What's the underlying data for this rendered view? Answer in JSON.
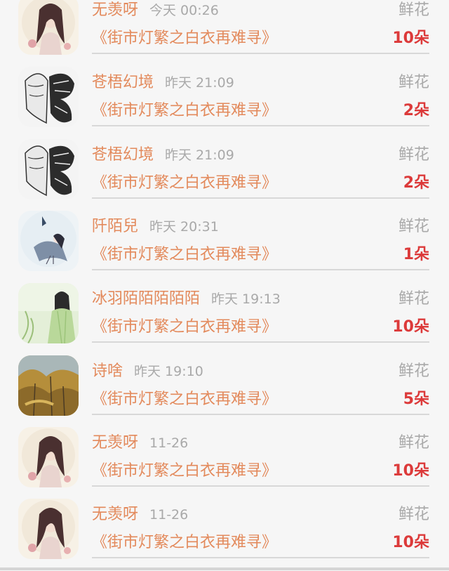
{
  "rows": [
    {
      "name": "无羡呀",
      "time": "今天 00:26",
      "gift": "鲜花",
      "book": "《街市灯繁之白衣再难寻》",
      "count": "10朵",
      "avatar": "girl-portrait"
    },
    {
      "name": "苍梧幻境",
      "time": "昨天 21:09",
      "gift": "鲜花",
      "book": "《街市灯繁之白衣再难寻》",
      "count": "2朵",
      "avatar": "butterfly-face"
    },
    {
      "name": "苍梧幻境",
      "time": "昨天 21:09",
      "gift": "鲜花",
      "book": "《街市灯繁之白衣再难寻》",
      "count": "2朵",
      "avatar": "butterfly-face"
    },
    {
      "name": "阡陌兒",
      "time": "昨天 20:31",
      "gift": "鲜花",
      "book": "《街市灯繁之白衣再难寻》",
      "count": "1朵",
      "avatar": "ink-figure"
    },
    {
      "name": "冰羽陌陌陌陌陌",
      "time": "昨天 19:13",
      "gift": "鲜花",
      "book": "《街市灯繁之白衣再难寻》",
      "count": "10朵",
      "avatar": "green-dress-girl"
    },
    {
      "name": "诗啥",
      "time": "昨天 19:10",
      "gift": "鲜花",
      "book": "《街市灯繁之白衣再难寻》",
      "count": "5朵",
      "avatar": "autumn-trees"
    },
    {
      "name": "无羡呀",
      "time": "11-26",
      "gift": "鲜花",
      "book": "《街市灯繁之白衣再难寻》",
      "count": "10朵",
      "avatar": "girl-portrait"
    },
    {
      "name": "无羡呀",
      "time": "11-26",
      "gift": "鲜花",
      "book": "《街市灯繁之白衣再难寻》",
      "count": "10朵",
      "avatar": "girl-portrait"
    }
  ],
  "colors": {
    "accent": "#e38a5c",
    "count": "#dc3a3a",
    "muted": "#a9a9a9",
    "background": "#f6f6f6"
  }
}
